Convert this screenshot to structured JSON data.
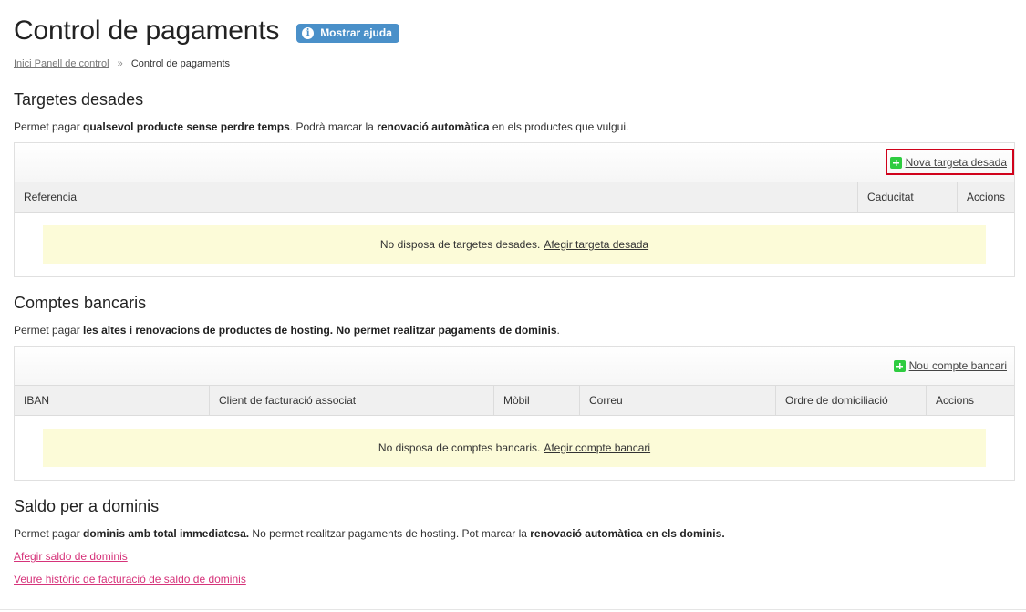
{
  "header": {
    "title": "Control de pagaments",
    "help_button": "Mostrar ajuda",
    "help_icon_glyph": "i"
  },
  "breadcrumb": {
    "link": "Inici Panell de control",
    "separator": "»",
    "current": "Control de pagaments"
  },
  "cards": {
    "title": "Targetes desades",
    "desc_prefix": "Permet pagar ",
    "desc_bold1": "qualsevol producte sense perdre temps",
    "desc_mid": ". Podrà marcar la ",
    "desc_bold2": "renovació automàtica",
    "desc_suffix": " en els productes que vulgui.",
    "new_link": "Nova targeta desada",
    "columns": [
      "Referencia",
      "Caducitat",
      "Accions"
    ],
    "empty_text": "No disposa de targetes desades.",
    "empty_link": "Afegir targeta desada"
  },
  "bank": {
    "title": "Comptes bancaris",
    "desc_prefix": "Permet pagar ",
    "desc_bold": "les altes i renovacions de productes de hosting. No permet realitzar pagaments de dominis",
    "desc_suffix": ".",
    "new_link": "Nou compte bancari",
    "columns": [
      "IBAN",
      "Client de facturació associat",
      "Mòbil",
      "Correu",
      "Ordre de domiciliació",
      "Accions"
    ],
    "empty_text": "No disposa de comptes bancaris.",
    "empty_link": "Afegir compte bancari"
  },
  "domains": {
    "title": "Saldo per a dominis",
    "desc_prefix": "Permet pagar ",
    "desc_bold1": "dominis amb total immediatesa.",
    "desc_mid": " No permet realitzar pagaments de hosting. Pot marcar la ",
    "desc_bold2": "renovació automàtica en els dominis.",
    "link_add": "Afegir saldo de dominis",
    "link_history": "Veure històric de facturació de saldo de dominis"
  },
  "colors": {
    "accent_blue": "#4a90c9",
    "add_green": "#2ecc40",
    "highlight_red": "#d0021b",
    "empty_yellow": "#fcfbd8",
    "link_pink": "#d6337a"
  },
  "icons": {
    "help": "info-icon",
    "add": "plus-icon"
  }
}
